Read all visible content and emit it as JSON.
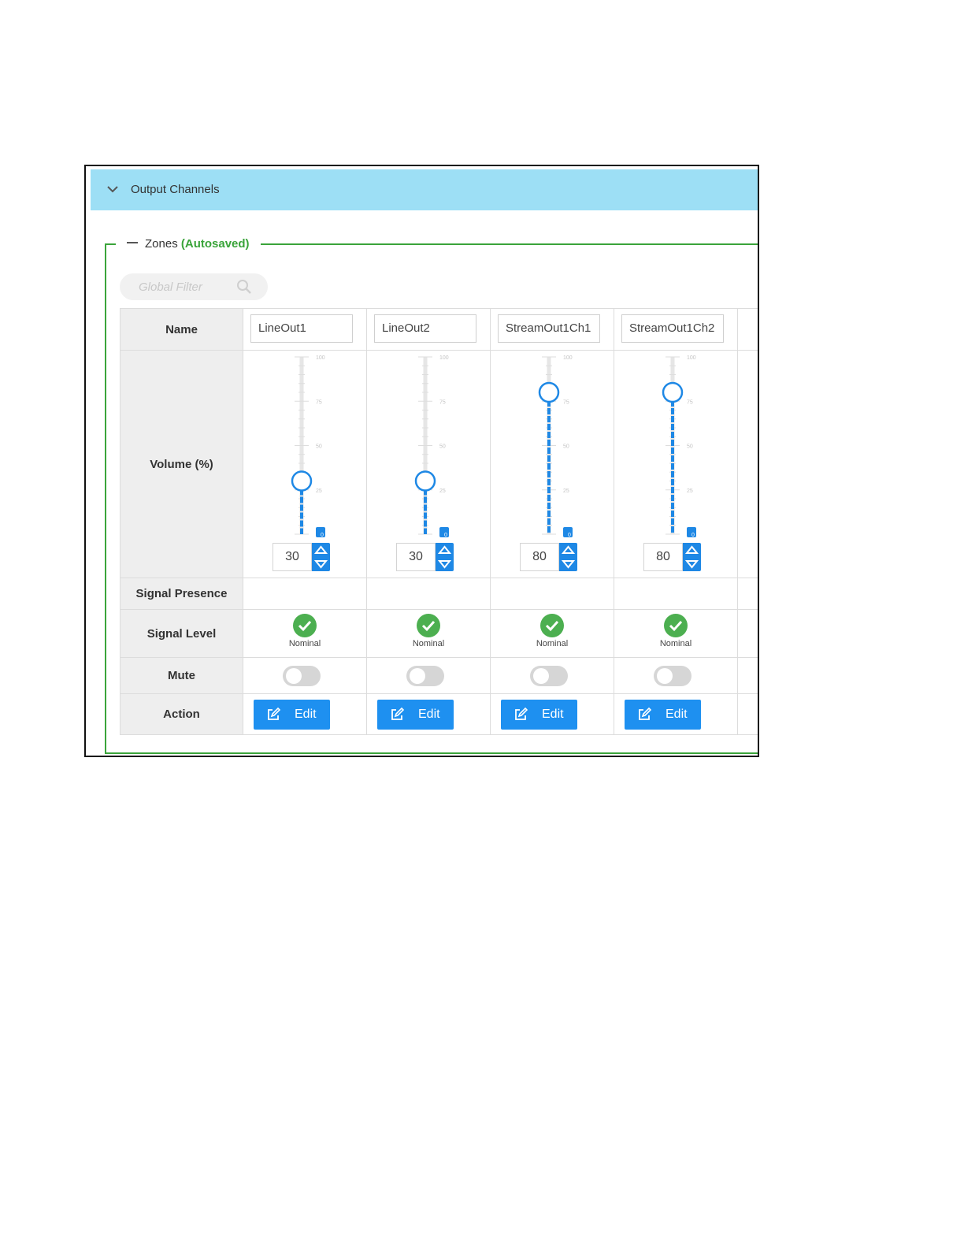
{
  "panel": {
    "title": "Output Channels"
  },
  "zones": {
    "legend_title": "Zones",
    "legend_status": "(Autosaved)",
    "filter_placeholder": "Global Filter"
  },
  "rows": {
    "name": "Name",
    "volume": "Volume (%)",
    "signal_presence": "Signal Presence",
    "signal_level": "Signal Level",
    "mute": "Mute",
    "action": "Action"
  },
  "slider_ticks": [
    "100",
    "75",
    "50",
    "25",
    "0"
  ],
  "channels": [
    {
      "name": "LineOut1",
      "volume": 30,
      "volume_text": "30",
      "signal_level": "Nominal",
      "muted": false,
      "action_label": "Edit"
    },
    {
      "name": "LineOut2",
      "volume": 30,
      "volume_text": "30",
      "signal_level": "Nominal",
      "muted": false,
      "action_label": "Edit"
    },
    {
      "name": "StreamOut1Ch1",
      "volume": 80,
      "volume_text": "80",
      "signal_level": "Nominal",
      "muted": false,
      "action_label": "Edit"
    },
    {
      "name": "StreamOut1Ch2",
      "volume": 80,
      "volume_text": "80",
      "signal_level": "Nominal",
      "muted": false,
      "action_label": "Edit"
    }
  ],
  "colors": {
    "header_bg": "#9ddff5",
    "accent_blue": "#1e88e5",
    "autosave_green": "#3aa43a",
    "ok_green": "#4caf50"
  }
}
